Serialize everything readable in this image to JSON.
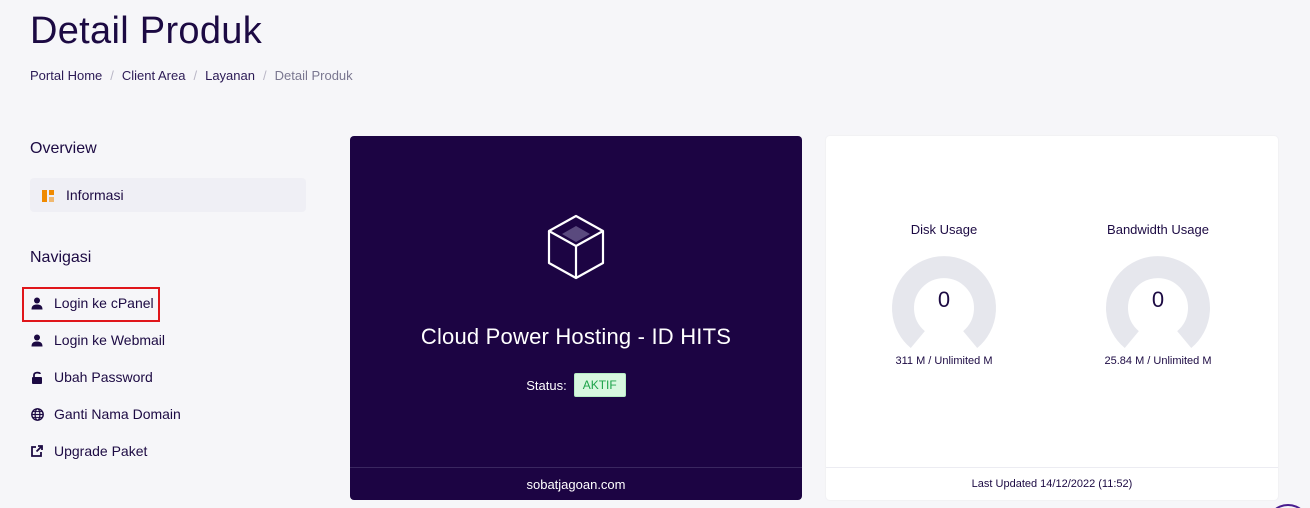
{
  "page": {
    "title": "Detail Produk"
  },
  "breadcrumb": [
    {
      "label": "Portal Home"
    },
    {
      "label": "Client Area"
    },
    {
      "label": "Layanan"
    },
    {
      "label": "Detail Produk"
    }
  ],
  "sidebar": {
    "overview_heading": "Overview",
    "info_item": "Informasi",
    "nav_heading": "Navigasi",
    "nav_items": [
      {
        "label": "Login ke cPanel",
        "icon": "user-icon"
      },
      {
        "label": "Login ke Webmail",
        "icon": "user-icon"
      },
      {
        "label": "Ubah Password",
        "icon": "lock-icon"
      },
      {
        "label": "Ganti Nama Domain",
        "icon": "globe-icon"
      },
      {
        "label": "Upgrade Paket",
        "icon": "external-link-icon"
      }
    ]
  },
  "product": {
    "icon": "cube-icon",
    "name": "Cloud Power Hosting - ID HITS",
    "status_label": "Status:",
    "status": "AKTIF",
    "domain": "sobatjagoan.com"
  },
  "usage": {
    "disk": {
      "title": "Disk Usage",
      "value": "0",
      "detail": "311 M / Unlimited M"
    },
    "bandwidth": {
      "title": "Bandwidth Usage",
      "value": "0",
      "detail": "25.84 M / Unlimited M"
    },
    "last_updated": "Last Updated 14/12/2022 (11:52)"
  },
  "colors": {
    "brand_dark": "#1c0443",
    "text": "#1c0a43",
    "accent_orange": "#f08a00",
    "status_green": "#1ea34a",
    "highlight_red": "#e0161b",
    "gauge_track": "#e6e7ed"
  }
}
